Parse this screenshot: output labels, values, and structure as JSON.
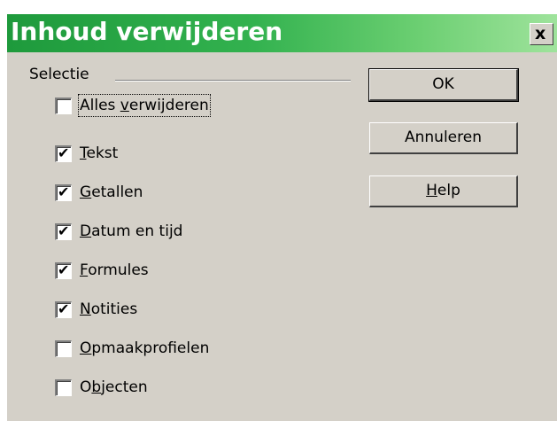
{
  "window": {
    "title": "Inhoud verwijderen",
    "close_glyph": "x"
  },
  "selection": {
    "group_label": "Selectie",
    "options": [
      {
        "label": "Alles verwijderen",
        "mnemonic_index": 6,
        "checked": false
      },
      {
        "label": "Tekst",
        "mnemonic_index": 0,
        "checked": true
      },
      {
        "label": "Getallen",
        "mnemonic_index": 0,
        "checked": true
      },
      {
        "label": "Datum en tijd",
        "mnemonic_index": 0,
        "checked": true
      },
      {
        "label": "Formules",
        "mnemonic_index": 0,
        "checked": true
      },
      {
        "label": "Notities",
        "mnemonic_index": 0,
        "checked": true
      },
      {
        "label": "Opmaakprofielen",
        "mnemonic_index": 0,
        "checked": false
      },
      {
        "label": "Objecten",
        "mnemonic_index": 1,
        "checked": false
      }
    ]
  },
  "buttons": {
    "ok": "OK",
    "cancel": "Annuleren",
    "help": "Help",
    "help_mnemonic_index": 0
  },
  "colors": {
    "title_gradient_start": "#1e9a3c",
    "title_gradient_end": "#9fe39c",
    "dialog_face": "#d4d0c8"
  }
}
